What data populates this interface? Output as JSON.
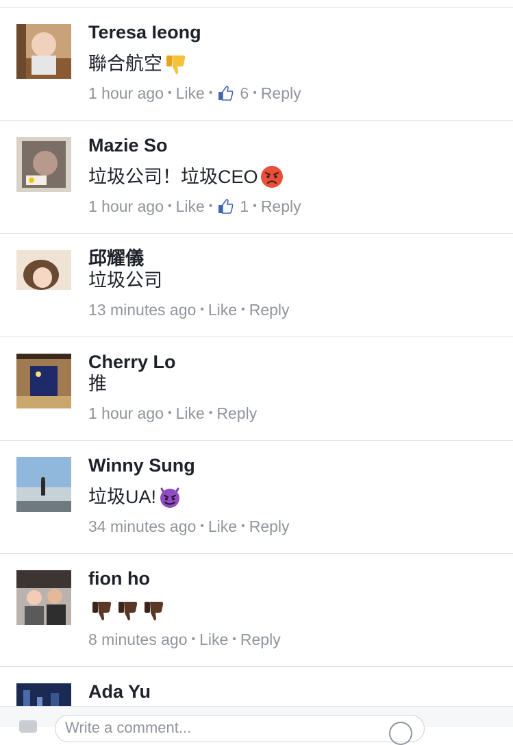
{
  "comments": [
    {
      "name": "Teresa Ieong",
      "text": "聯合航空",
      "emoji": [
        "thumbs-down-icon"
      ],
      "time": "1 hour ago",
      "like_label": "Like",
      "like_count": "6",
      "reply_label": "Reply"
    },
    {
      "name": "Mazie So",
      "text": "垃圾公司！垃圾CEO",
      "emoji": [
        "angry-face-icon"
      ],
      "time": "1 hour ago",
      "like_label": "Like",
      "like_count": "1",
      "reply_label": "Reply"
    },
    {
      "name": "邱耀儀",
      "text": "垃圾公司",
      "time": "13 minutes ago",
      "like_label": "Like",
      "reply_label": "Reply"
    },
    {
      "name": "Cherry Lo",
      "text": "推",
      "time": "1 hour ago",
      "like_label": "Like",
      "reply_label": "Reply"
    },
    {
      "name": "Winny Sung",
      "text": "垃圾UA!",
      "emoji": [
        "devil-face-icon"
      ],
      "time": "34 minutes ago",
      "like_label": "Like",
      "reply_label": "Reply"
    },
    {
      "name": "fion ho",
      "text": "",
      "emoji": [
        "thumbs-down-dark-icon",
        "thumbs-down-dark-icon",
        "thumbs-down-dark-icon"
      ],
      "time": "8 minutes ago",
      "like_label": "Like",
      "reply_label": "Reply"
    },
    {
      "name": "Ada Yu"
    }
  ],
  "composer": {
    "placeholder": "Write a comment..."
  },
  "colors": {
    "name_text": "#1d2129",
    "meta_text": "#90949c",
    "divider": "#dddfe2",
    "like_blue": "#4267b2"
  }
}
